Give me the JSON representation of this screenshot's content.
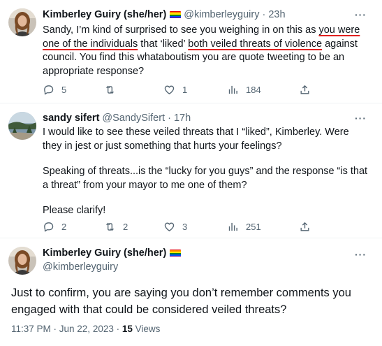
{
  "colors": {
    "text": "#0f1419",
    "secondary": "#536471",
    "underline": "#e0201e",
    "divider": "#eff3f4"
  },
  "tweets": [
    {
      "name": "Kimberley Guiry (she/her)",
      "handle": "@kimberleyguiry",
      "sep": "·",
      "time": "23h",
      "more": "···",
      "text": {
        "a": "Sandy, I’m kind of surprised to see you weighing in on this as ",
        "u1": "you were one of the individuals",
        "b": " that ‘liked’ ",
        "u2": "both veiled threats of violence",
        "c": " against council. You find this whataboutism you are quote tweeting to be an appropriate response?"
      },
      "stats": {
        "replies": "5",
        "retweets": "",
        "likes": "1",
        "views": "184"
      }
    },
    {
      "name": "sandy sifert",
      "handle": "@SandySifert",
      "sep": "·",
      "time": "17h",
      "more": "···",
      "paragraphs": [
        "I would like to see these veiled threats that I “liked”, Kimberley. Were they in jest or just something that hurts your feelings?",
        "Speaking of threats...is the “lucky for you guys” and the response “is that a threat” from your mayor to me one of them?",
        "Please clarify!"
      ],
      "stats": {
        "replies": "2",
        "retweets": "2",
        "likes": "3",
        "views": "251"
      }
    },
    {
      "name": "Kimberley Guiry (she/her)",
      "handle": "@kimberleyguiry",
      "more": "···",
      "text": "Just to confirm, you are saying you don’t remember comments you engaged with that could be considered veiled threats?",
      "timestamp": "11:37 PM · Jun 22, 2023 · ",
      "views_count": "15",
      "views_label": " Views"
    }
  ]
}
